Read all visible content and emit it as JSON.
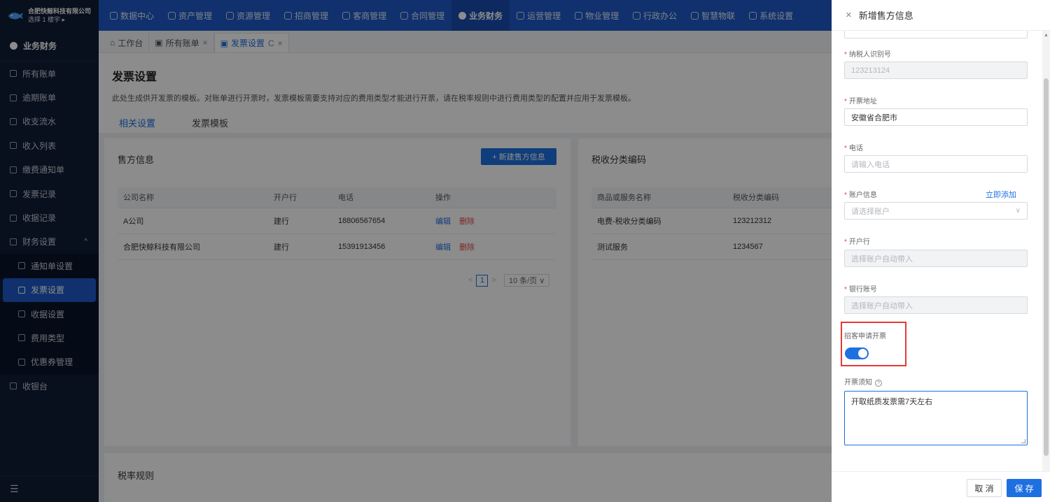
{
  "brand": {
    "company": "合肥快鲸科技有限公司",
    "building": "选择 1 楼宇 ▸"
  },
  "topnav": [
    {
      "label": "数据中心",
      "icon": "clock-icon"
    },
    {
      "label": "资产管理",
      "icon": "cube-icon"
    },
    {
      "label": "资源管理",
      "icon": "document-icon"
    },
    {
      "label": "招商管理",
      "icon": "location-icon"
    },
    {
      "label": "客商管理",
      "icon": "users-icon"
    },
    {
      "label": "合同管理",
      "icon": "contract-icon"
    },
    {
      "label": "业务财务",
      "icon": "finance-icon",
      "active": true
    },
    {
      "label": "运营管理",
      "icon": "operation-icon"
    },
    {
      "label": "物业管理",
      "icon": "property-icon"
    },
    {
      "label": "行政办公",
      "icon": "monitor-icon"
    },
    {
      "label": "智慧物联",
      "icon": "iot-icon"
    },
    {
      "label": "系统设置",
      "icon": "gear-icon"
    }
  ],
  "sidebar": {
    "header": "业务财务",
    "items": [
      {
        "label": "所有账单"
      },
      {
        "label": "逾期账单"
      },
      {
        "label": "收支流水"
      },
      {
        "label": "收入列表"
      },
      {
        "label": "缴费通知单"
      },
      {
        "label": "发票记录"
      },
      {
        "label": "收据记录"
      },
      {
        "label": "财务设置",
        "caret": "^"
      }
    ],
    "subitems": [
      {
        "label": "通知单设置"
      },
      {
        "label": "发票设置",
        "active": true
      },
      {
        "label": "收据设置"
      },
      {
        "label": "费用类型"
      },
      {
        "label": "优惠券管理"
      }
    ],
    "after": [
      {
        "label": "收银台"
      }
    ],
    "bottom_icon": "menu-fold-icon"
  },
  "page_tabs": [
    {
      "label": "工作台",
      "icon": "home-icon"
    },
    {
      "label": "所有账单",
      "icon": "bill-icon",
      "close": "×"
    },
    {
      "label": "发票设置",
      "icon": "invoice-icon",
      "refresh": "C",
      "close": "×",
      "active": true
    }
  ],
  "page": {
    "title": "发票设置",
    "desc": "此处生成供开发票的模板。对账单进行开票时，发票模板需要支持对应的费用类型才能进行开票，请在税率规则中进行费用类型的配置并应用于发票模板。",
    "subtabs": [
      "相关设置",
      "发票模板"
    ]
  },
  "seller": {
    "title": "售方信息",
    "new_button": "+ 新建售方信息",
    "headers": [
      "公司名称",
      "开户行",
      "电话",
      "操作"
    ],
    "rows": [
      {
        "company": "A公司",
        "bank": "建行",
        "phone": "18806567654",
        "edit": "编辑",
        "delete": "删除"
      },
      {
        "company": "合肥快鲸科技有限公司",
        "bank": "建行",
        "phone": "15391913456",
        "edit": "编辑",
        "delete": "删除"
      }
    ],
    "pager": {
      "prev": "<",
      "page": "1",
      "next": ">",
      "size": "10 条/页 ∨"
    }
  },
  "tax": {
    "title": "税收分类编码",
    "headers": [
      "商品或服务名称",
      "税收分类编码"
    ],
    "rows": [
      {
        "name": "电费-税收分类编码",
        "code": "123212312"
      },
      {
        "name": "测试服务",
        "code": "1234567"
      }
    ]
  },
  "tax_rule": {
    "title": "税率规则"
  },
  "drawer": {
    "title": "新增售方信息",
    "close": "×",
    "taxpayer_label": "纳税人识别号",
    "taxpayer_value": "123213124",
    "address_label": "开票地址",
    "address_value": "安徽省合肥市",
    "phone_label": "电话",
    "phone_placeholder": "请输入电话",
    "account_label": "账户信息",
    "account_add": "立即添加",
    "account_placeholder": "请选择账户",
    "bank_label": "开户行",
    "bank_placeholder": "选择账户自动带入",
    "bankno_label": "银行账号",
    "bankno_placeholder": "选择账户自动带入",
    "apply_label": "招客申请开票",
    "apply_enabled": true,
    "notice_label": "开票须知",
    "notice_help": "?",
    "notice_value": "开取纸质发票需7天左右",
    "cancel": "取 消",
    "save": "保 存"
  }
}
